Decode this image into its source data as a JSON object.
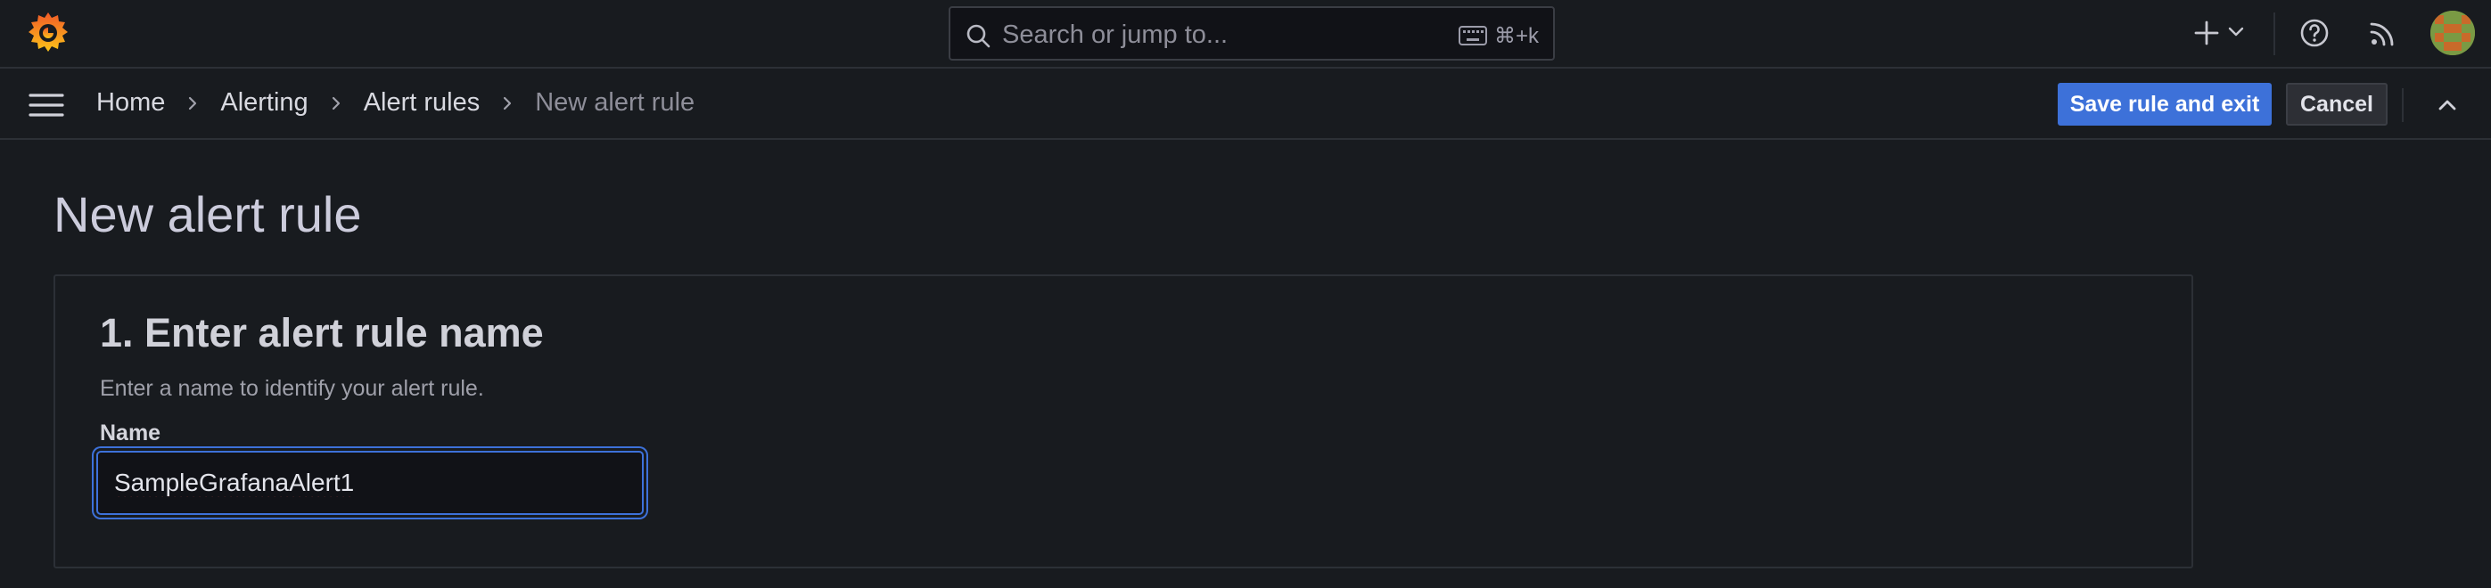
{
  "app": {
    "name": "Grafana",
    "brand_color": "#f46800",
    "accent_color": "#3d71d9"
  },
  "topbar": {
    "search_placeholder": "Search or jump to...",
    "search_shortcut": "⌘+k",
    "icons": [
      "grafana-logo-icon",
      "search-icon",
      "keyboard-icon",
      "plus-icon",
      "chevron-down-icon",
      "help-icon",
      "news-feed-icon",
      "user-avatar"
    ]
  },
  "breadcrumb": {
    "items": [
      {
        "label": "Home"
      },
      {
        "label": "Alerting"
      },
      {
        "label": "Alert rules"
      },
      {
        "label": "New alert rule"
      }
    ]
  },
  "actions": {
    "save_label": "Save rule and exit",
    "cancel_label": "Cancel"
  },
  "page": {
    "title": "New alert rule"
  },
  "step1": {
    "title": "1. Enter alert rule name",
    "description": "Enter a name to identify your alert rule.",
    "name_label": "Name",
    "name_value": "SampleGrafanaAlert1"
  }
}
